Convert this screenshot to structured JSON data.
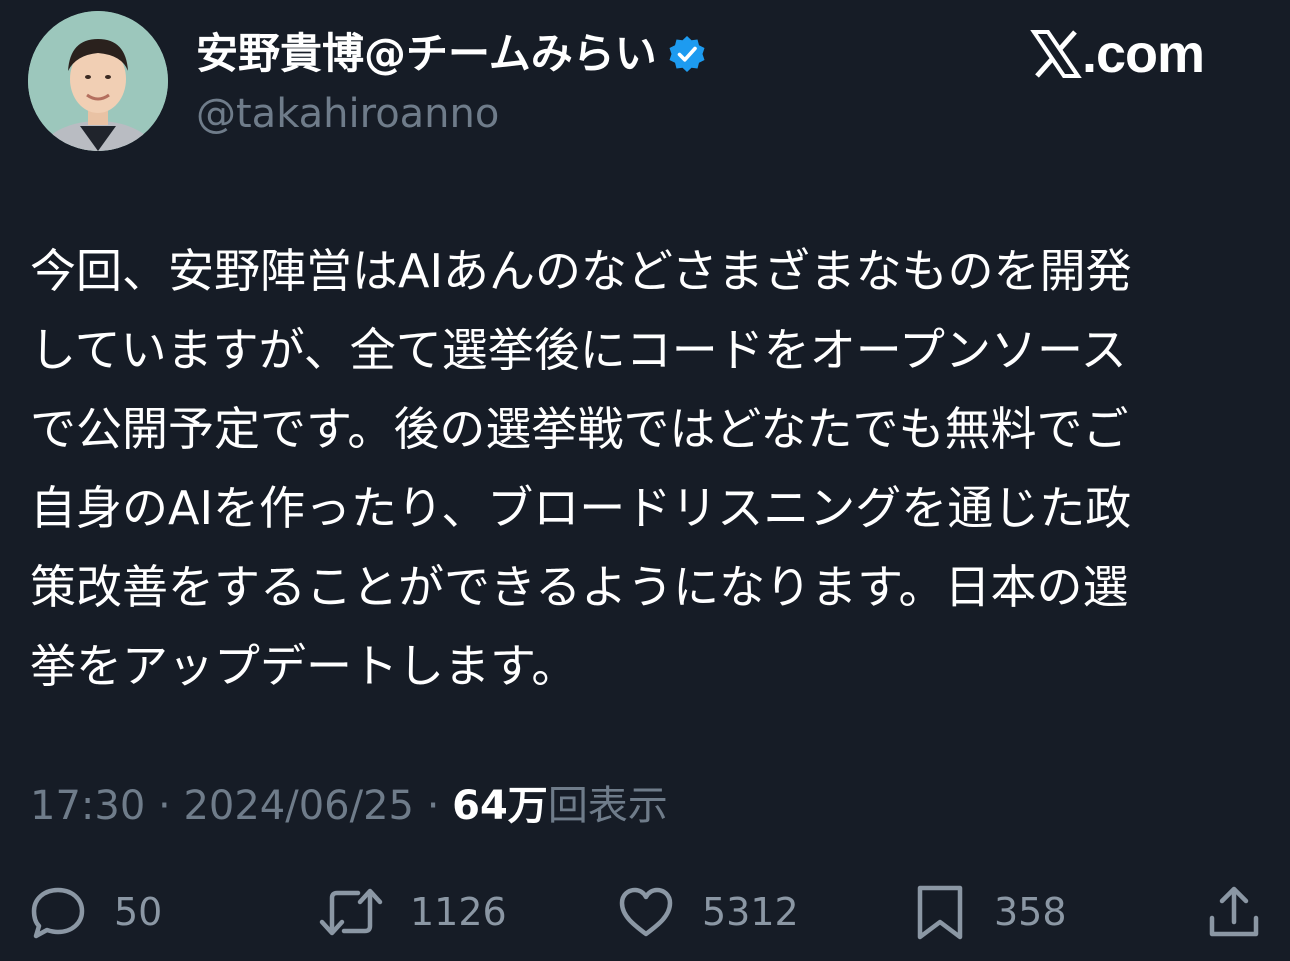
{
  "author": {
    "display_name": "安野貴博@チームみらい",
    "handle": "@takahiroanno",
    "verified": true,
    "verified_icon": "verified-badge-icon"
  },
  "brand": {
    "suffix": ".com",
    "icon": "x-logo-icon"
  },
  "tweet": {
    "lines": [
      "今回、安野陣営はAIあんのなどさまざまなものを開発",
      "していますが、全て選挙後にコードをオープンソース",
      "で公開予定です。後の選挙戦ではどなたでも無料でご",
      "自身のAIを作ったり、ブロードリスニングを通じた政",
      "策改善をすることができるようになります。日本の選",
      "挙をアップデートします。"
    ]
  },
  "meta": {
    "time": "17:30",
    "separator": " · ",
    "date": "2024/06/25",
    "views_count": "64万",
    "views_label": "回表示"
  },
  "actions": {
    "reply": {
      "icon": "reply-icon",
      "count": "50"
    },
    "retweet": {
      "icon": "retweet-icon",
      "count": "1126"
    },
    "like": {
      "icon": "heart-icon",
      "count": "5312"
    },
    "bookmark": {
      "icon": "bookmark-icon",
      "count": "358"
    },
    "share": {
      "icon": "share-icon"
    }
  },
  "colors": {
    "background": "#161c26",
    "text": "#ffffff",
    "secondary": "#6f7c8a",
    "verified": "#1d9bf0"
  }
}
